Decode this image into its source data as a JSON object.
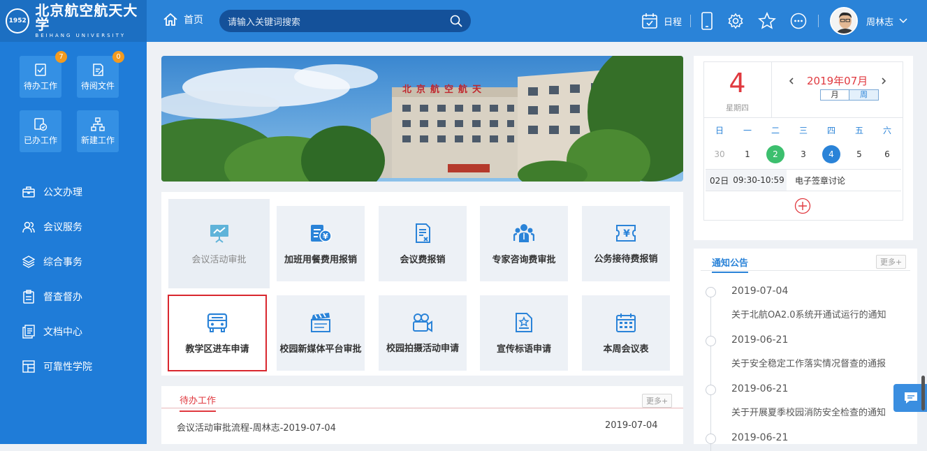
{
  "header": {
    "logo_cn": "北京航空航天大学",
    "logo_en": "BEIHANG UNIVERSITY",
    "home_label": "首页",
    "search_placeholder": "请输入关键词搜索",
    "schedule_label": "日程",
    "user_name": "周林志",
    "accent": "#2a83d8"
  },
  "sidebar": {
    "quick": [
      {
        "label": "待办工作",
        "badge": "7",
        "icon": "check-doc-icon"
      },
      {
        "label": "待阅文件",
        "badge": "0",
        "icon": "edit-doc-icon"
      },
      {
        "label": "已办工作",
        "icon": "done-doc-icon"
      },
      {
        "label": "新建工作",
        "icon": "org-chart-icon"
      }
    ],
    "menu": [
      {
        "label": "公文办理",
        "icon": "briefcase-icon"
      },
      {
        "label": "会议服务",
        "icon": "users-icon"
      },
      {
        "label": "综合事务",
        "icon": "layers-icon"
      },
      {
        "label": "督查督办",
        "icon": "clipboard-icon"
      },
      {
        "label": "文档中心",
        "icon": "documents-icon"
      },
      {
        "label": "可靠性学院",
        "icon": "layout-icon"
      }
    ]
  },
  "tiles": [
    {
      "label": "会议活动审批",
      "icon": "presentation-icon"
    },
    {
      "label": "加班用餐费用报销",
      "icon": "yen-reimburse-icon"
    },
    {
      "label": "会议费报销",
      "icon": "invoice-icon"
    },
    {
      "label": "专家咨询费审批",
      "icon": "experts-icon"
    },
    {
      "label": "公务接待费报销",
      "icon": "yen-ticket-icon"
    },
    {
      "label": "教学区进车申请",
      "icon": "car-icon"
    },
    {
      "label": "校园新媒体平台审批",
      "icon": "clapper-icon"
    },
    {
      "label": "校园拍摄活动申请",
      "icon": "video-camera-icon"
    },
    {
      "label": "宣传标语申请",
      "icon": "star-doc-icon"
    },
    {
      "label": "本周会议表",
      "icon": "calendar-grid-icon"
    }
  ],
  "todo": {
    "title": "待办工作",
    "more": "更多+",
    "items": [
      {
        "text": "会议活动审批流程-周林志-2019-07-04",
        "date": "2019-07-04"
      }
    ]
  },
  "calendar": {
    "day": "4",
    "weekday": "星期四",
    "month_label": "2019年07月",
    "view_month": "月",
    "view_week": "周",
    "weekdays": [
      "日",
      "一",
      "二",
      "三",
      "四",
      "五",
      "六"
    ],
    "dates": [
      "30",
      "1",
      "2",
      "3",
      "4",
      "5",
      "6"
    ],
    "event": {
      "date": "02日",
      "time": "09:30-10:59",
      "title": "电子签章讨论"
    }
  },
  "notice": {
    "title": "通知公告",
    "more": "更多+",
    "items": [
      {
        "date": "2019-07-04",
        "text": "关于北航OA2.0系统开通试运行的通知"
      },
      {
        "date": "2019-06-21",
        "text": "关于安全稳定工作落实情况督查的通报"
      },
      {
        "date": "2019-06-21",
        "text": "关于开展夏季校园消防安全检查的通知"
      },
      {
        "date": "2019-06-21",
        "text": ""
      }
    ]
  }
}
